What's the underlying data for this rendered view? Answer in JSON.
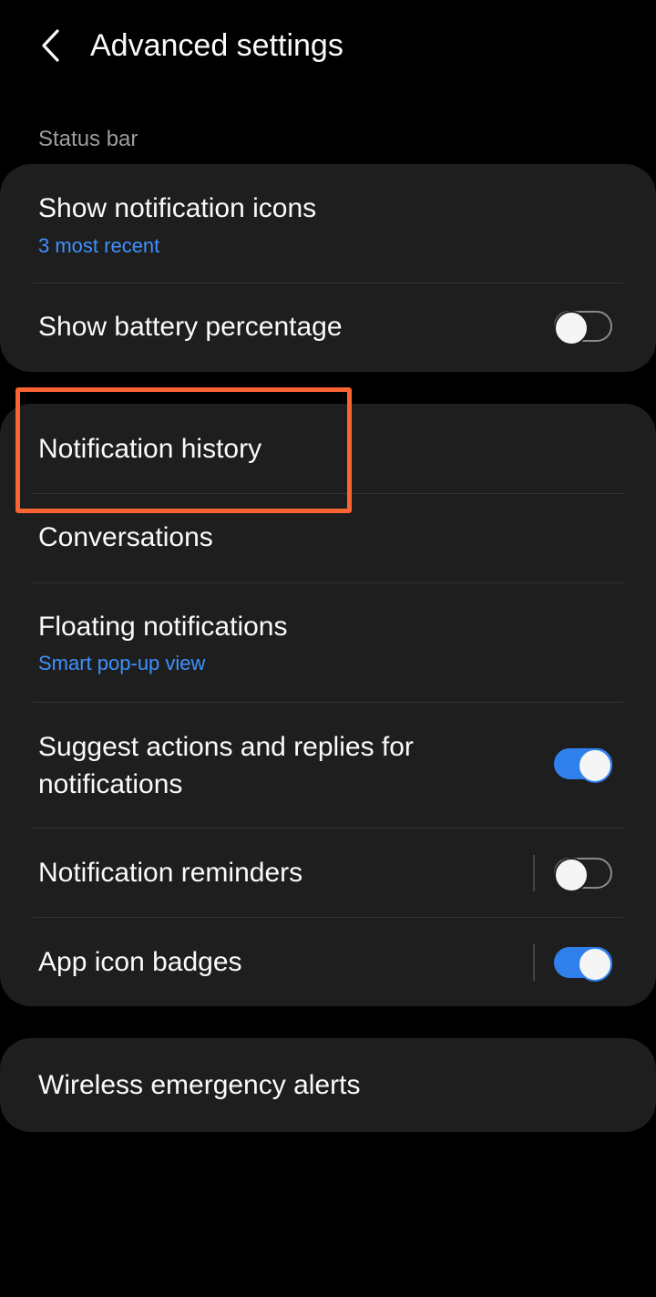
{
  "header": {
    "title": "Advanced settings",
    "back_icon": "chevron-left-icon"
  },
  "status_bar_section": {
    "label": "Status bar",
    "items": [
      {
        "title": "Show notification icons",
        "subtitle": "3 most recent"
      },
      {
        "title": "Show battery percentage",
        "toggle": false
      }
    ]
  },
  "notifications_section": {
    "items": [
      {
        "title": "Notification history"
      },
      {
        "title": "Conversations"
      },
      {
        "title": "Floating notifications",
        "subtitle": "Smart pop-up view"
      },
      {
        "title": "Suggest actions and replies for notifications",
        "toggle": true
      },
      {
        "title": "Notification reminders",
        "toggle": false
      },
      {
        "title": "App icon badges",
        "toggle": true
      }
    ]
  },
  "alerts_section": {
    "items": [
      {
        "title": "Wireless emergency alerts"
      }
    ]
  },
  "colors": {
    "background": "#000000",
    "card": "#1e1e1e",
    "accent": "#3e91ff",
    "toggle_on": "#2f80ed",
    "highlight": "#fa6432"
  }
}
